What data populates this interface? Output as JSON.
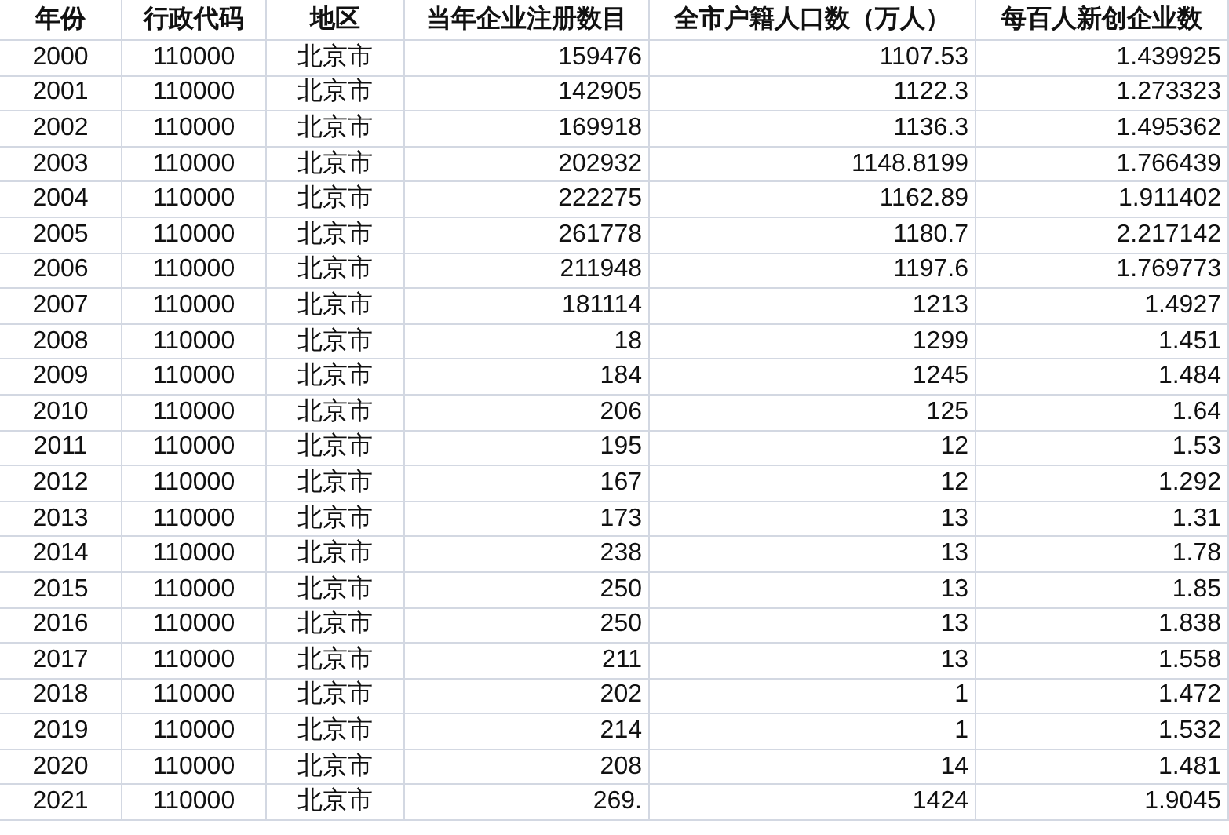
{
  "table": {
    "columns": [
      "年份",
      "行政代码",
      "地区",
      "当年企业注册数目",
      "全市户籍人口数（万人）",
      "每百人新创企业数"
    ],
    "rows": [
      [
        "2000",
        "110000",
        "北京市",
        "159476",
        "1107.53",
        "1.439925"
      ],
      [
        "2001",
        "110000",
        "北京市",
        "142905",
        "1122.3",
        "1.273323"
      ],
      [
        "2002",
        "110000",
        "北京市",
        "169918",
        "1136.3",
        "1.495362"
      ],
      [
        "2003",
        "110000",
        "北京市",
        "202932",
        "1148.8199",
        "1.766439"
      ],
      [
        "2004",
        "110000",
        "北京市",
        "222275",
        "1162.89",
        "1.911402"
      ],
      [
        "2005",
        "110000",
        "北京市",
        "261778",
        "1180.7",
        "2.217142"
      ],
      [
        "2006",
        "110000",
        "北京市",
        "211948",
        "1197.6",
        "1.769773"
      ],
      [
        "2007",
        "110000",
        "北京市",
        "181114",
        "1213",
        "1.4927"
      ],
      [
        "2008",
        "110000",
        "北京市",
        "18",
        "1299",
        "1.451"
      ],
      [
        "2009",
        "110000",
        "北京市",
        "184",
        "1245",
        "1.484"
      ],
      [
        "2010",
        "110000",
        "北京市",
        "206",
        "125",
        "1.64"
      ],
      [
        "2011",
        "110000",
        "北京市",
        "195",
        "12",
        "1.53"
      ],
      [
        "2012",
        "110000",
        "北京市",
        "167",
        "12",
        "1.292"
      ],
      [
        "2013",
        "110000",
        "北京市",
        "173",
        "13",
        "1.31"
      ],
      [
        "2014",
        "110000",
        "北京市",
        "238",
        "13",
        "1.78"
      ],
      [
        "2015",
        "110000",
        "北京市",
        "250",
        "13",
        "1.85"
      ],
      [
        "2016",
        "110000",
        "北京市",
        "250",
        "13",
        "1.838"
      ],
      [
        "2017",
        "110000",
        "北京市",
        "211",
        "13",
        "1.558"
      ],
      [
        "2018",
        "110000",
        "北京市",
        "202",
        "1",
        "1.472"
      ],
      [
        "2019",
        "110000",
        "北京市",
        "214",
        "1",
        "1.532"
      ],
      [
        "2020",
        "110000",
        "北京市",
        "208",
        "14",
        "1.481"
      ],
      [
        "2021",
        "110000",
        "北京市",
        "269.",
        "1424",
        "1.9045"
      ]
    ]
  }
}
